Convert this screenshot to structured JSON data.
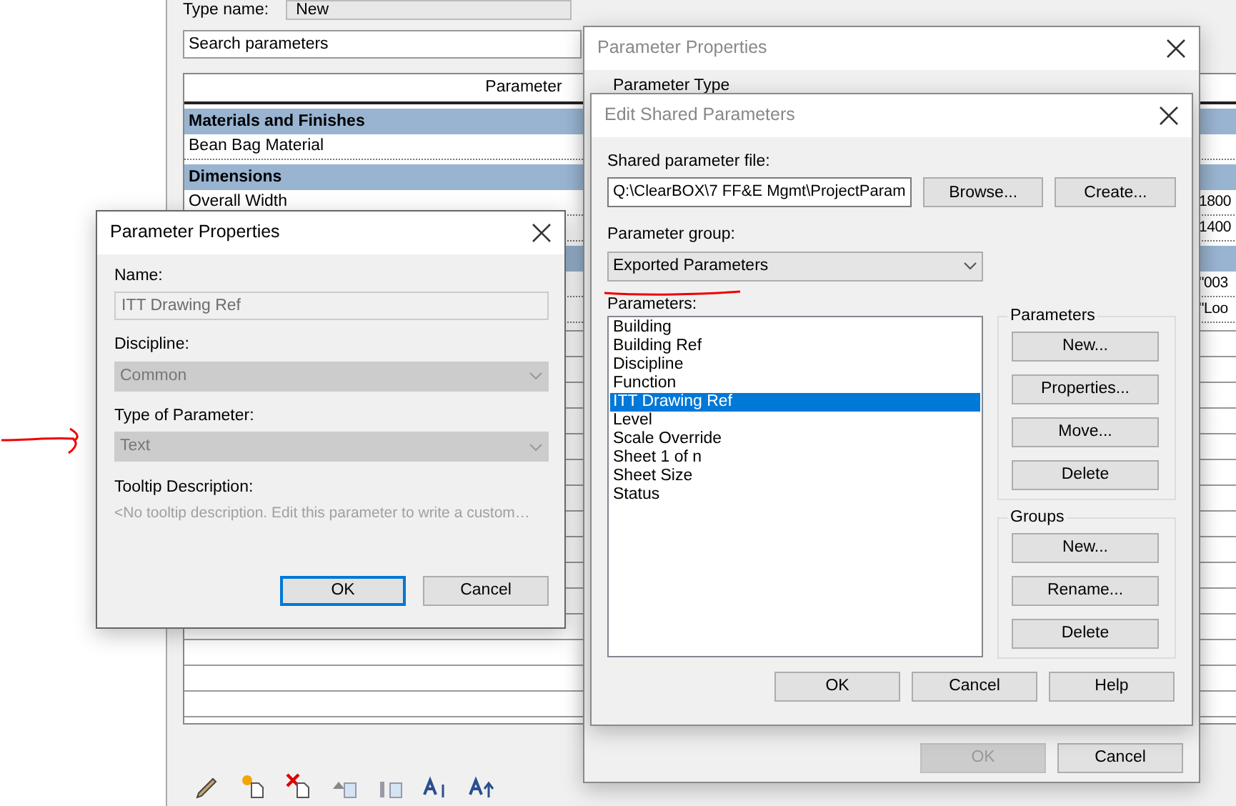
{
  "family_types": {
    "type_name_label": "Type name:",
    "type_name": "New",
    "search": {
      "placeholder": "Search parameters"
    },
    "table": {
      "columns": [
        "Parameter"
      ],
      "rows": [
        {
          "kind": "group",
          "label": "Materials and Finishes"
        },
        {
          "kind": "param",
          "label": "Bean Bag Material"
        },
        {
          "kind": "group",
          "label": "Dimensions"
        },
        {
          "kind": "param",
          "label": "Overall Width",
          "value": "1800"
        },
        {
          "kind": "param",
          "value": "1400"
        },
        {
          "kind": "group"
        },
        {
          "kind": "param",
          "value": "\"003"
        },
        {
          "kind": "param",
          "value": "\"Loo"
        }
      ]
    }
  },
  "parameter_properties_back": {
    "title": "Parameter Properties",
    "parameter_type_label": "Parameter Type",
    "buttons": [
      {
        "label": "OK",
        "disabled": true
      },
      {
        "label": "Cancel",
        "disabled": false
      }
    ]
  },
  "edit_shared_parameters": {
    "title": "Edit Shared Parameters",
    "file_label": "Shared parameter file:",
    "file_path": "Q:\\ClearBOX\\7 FF&E Mgmt\\ProjectParam",
    "file_buttons": [
      "Browse...",
      "Create..."
    ],
    "group_label": "Parameter group:",
    "group_value": "Exported Parameters",
    "parameters_label": "Parameters:",
    "parameters": [
      {
        "label": "Building",
        "selected": false
      },
      {
        "label": "Building Ref",
        "selected": false
      },
      {
        "label": "Discipline",
        "selected": false
      },
      {
        "label": "Function",
        "selected": false
      },
      {
        "label": "ITT Drawing Ref",
        "selected": true
      },
      {
        "label": "Level",
        "selected": false
      },
      {
        "label": "Scale Override",
        "selected": false
      },
      {
        "label": "Sheet 1 of n",
        "selected": false
      },
      {
        "label": "Sheet Size",
        "selected": false
      },
      {
        "label": "Status",
        "selected": false
      }
    ],
    "parameter_buttons": {
      "title": "Parameters",
      "buttons": [
        "New...",
        "Properties...",
        "Move...",
        "Delete"
      ]
    },
    "group_buttons": {
      "title": "Groups",
      "buttons": [
        "New...",
        "Rename...",
        "Delete"
      ]
    },
    "buttons": [
      "OK",
      "Cancel",
      "Help"
    ]
  },
  "parameter_properties": {
    "title": "Parameter Properties",
    "name_label": "Name:",
    "name": "ITT Drawing Ref",
    "name_disabled": true,
    "discipline_label": "Discipline:",
    "discipline": "Common",
    "discipline_disabled": true,
    "type_label": "Type of Parameter:",
    "type": "Text",
    "type_disabled": true,
    "tooltip_label": "Tooltip Description:",
    "tooltip": "<No tooltip description. Edit this parameter to write a custom…",
    "buttons": [
      {
        "label": "OK",
        "focused": true
      },
      {
        "label": "Cancel",
        "focused": false
      }
    ]
  }
}
